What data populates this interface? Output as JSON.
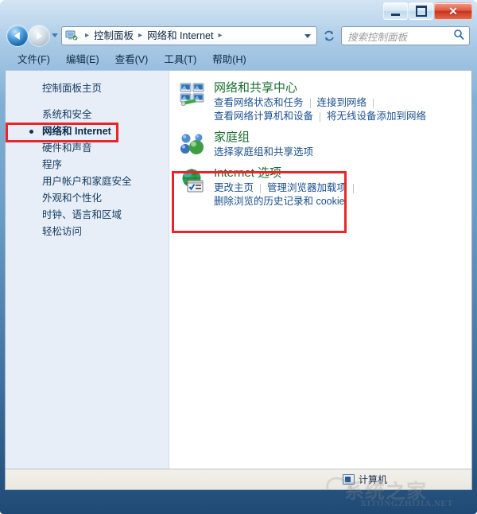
{
  "window": {
    "controls": {
      "minimize_label": "–",
      "maximize_label": "□",
      "close_label": "✕"
    }
  },
  "navbar": {
    "back_name": "back-button",
    "forward_name": "forward-button",
    "breadcrumbs": [
      "控制面板",
      "网络和 Internet"
    ],
    "separator": "▸",
    "search": {
      "placeholder": "搜索控制面板",
      "value": ""
    }
  },
  "menubar": {
    "items": [
      "文件(F)",
      "编辑(E)",
      "查看(V)",
      "工具(T)",
      "帮助(H)"
    ]
  },
  "sidebar": {
    "home_label": "控制面板主页",
    "items": [
      {
        "label": "系统和安全",
        "current": false
      },
      {
        "label": "网络和 Internet",
        "current": true
      },
      {
        "label": "硬件和声音",
        "current": false
      },
      {
        "label": "程序",
        "current": false
      },
      {
        "label": "用户帐户和家庭安全",
        "current": false
      },
      {
        "label": "外观和个性化",
        "current": false
      },
      {
        "label": "时钟、语言和区域",
        "current": false
      },
      {
        "label": "轻松访问",
        "current": false
      }
    ]
  },
  "content": {
    "categories": [
      {
        "icon": "network-sharing-icon",
        "title": "网络和共享中心",
        "link_rows": [
          [
            "查看网络状态和任务",
            "连接到网络"
          ],
          [
            "查看网络计算机和设备",
            "将无线设备添加到网络"
          ]
        ]
      },
      {
        "icon": "homegroup-icon",
        "title": "家庭组",
        "link_rows": [
          [
            "选择家庭组和共享选项"
          ]
        ]
      },
      {
        "icon": "internet-options-icon",
        "title": "Internet 选项",
        "link_rows": [
          [
            "更改主页",
            "管理浏览器加载项"
          ],
          [
            "删除浏览的历史记录和 cookie"
          ]
        ]
      }
    ]
  },
  "statusbar": {
    "text": "计算机"
  },
  "watermark": {
    "main": "系统之家",
    "sub": "XITONGZHIJIA.NET"
  },
  "colors": {
    "highlight_red": "#e8262a",
    "category_title_green": "#1a6e2e",
    "link_blue": "#1a4f8f",
    "sidebar_bg": "#e7eef8"
  }
}
